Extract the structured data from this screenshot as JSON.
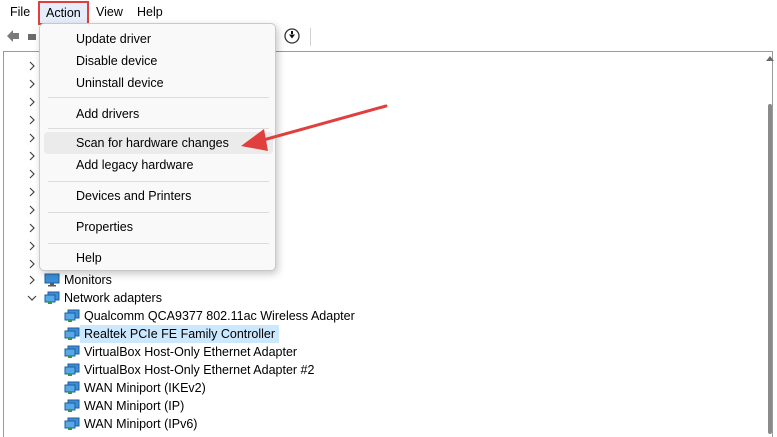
{
  "menubar": {
    "file": "File",
    "action": "Action",
    "view": "View",
    "help": "Help"
  },
  "context_menu": {
    "items": [
      "Update driver",
      "Disable device",
      "Uninstall device",
      "Add drivers",
      "Scan for hardware changes",
      "Add legacy hardware",
      "Devices and Printers",
      "Properties",
      "Help"
    ],
    "highlighted": "Scan for hardware changes"
  },
  "tree": {
    "categories": [
      "Monitors",
      "Network adapters"
    ],
    "network_adapters": [
      "Qualcomm QCA9377 802.11ac Wireless Adapter",
      "Realtek PCIe FE Family Controller",
      "VirtualBox Host-Only Ethernet Adapter",
      "VirtualBox Host-Only Ethernet Adapter #2",
      "WAN Miniport (IKEv2)",
      "WAN Miniport (IP)",
      "WAN Miniport (IPv6)"
    ],
    "selected": "Realtek PCIe FE Family Controller"
  },
  "colors": {
    "annotation_red": "#e0403d",
    "selection": "#cce8ff",
    "menu_hover": "#ebebeb"
  },
  "icons": {
    "category": "monitor-icon",
    "adapter": "network-adapter-icon"
  }
}
